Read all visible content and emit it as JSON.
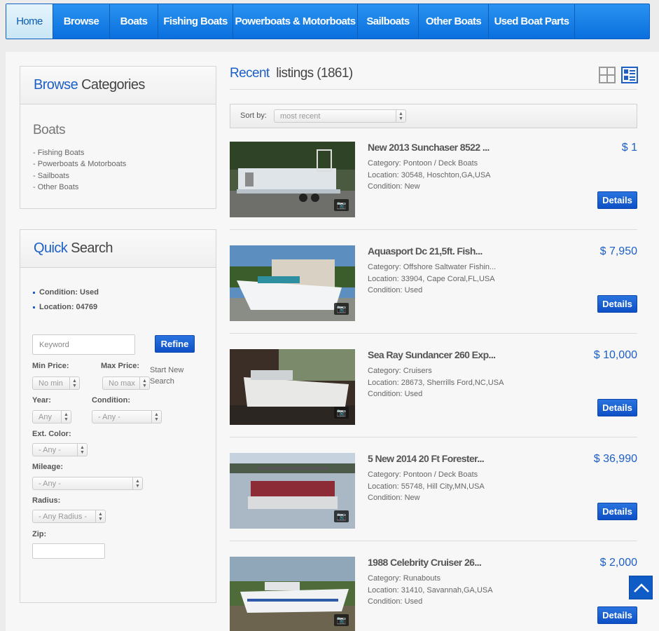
{
  "nav": {
    "items": [
      {
        "label": "Home"
      },
      {
        "label": "Browse"
      },
      {
        "label": "Boats"
      },
      {
        "label": "Fishing Boats"
      },
      {
        "label": "Powerboats & Motorboats"
      },
      {
        "label": "Sailboats"
      },
      {
        "label": "Other Boats"
      },
      {
        "label": "Used Boat Parts"
      }
    ],
    "active": "Home"
  },
  "categories": {
    "title_accent": "Browse",
    "title_rest": "Categories",
    "section": "Boats",
    "items": [
      "- Fishing Boats",
      "- Powerboats & Motorboats",
      "- Sailboats",
      "- Other Boats"
    ]
  },
  "quick_search": {
    "title_accent": "Quick",
    "title_rest": "Search",
    "filters": [
      "Condition: Used",
      "Location: 04769"
    ],
    "keyword_placeholder": "Keyword",
    "refine_label": "Refine",
    "min_price_label": "Min Price:",
    "min_price_value": "No min",
    "max_price_label": "Max Price:",
    "max_price_value": "No max",
    "start_new_search": "Start New Search",
    "year_label": "Year:",
    "year_value": "Any",
    "condition_label": "Condition:",
    "condition_value": "- Any -",
    "ext_color_label": "Ext. Color:",
    "ext_color_value": "- Any -",
    "mileage_label": "Mileage:",
    "mileage_value": "- Any -",
    "radius_label": "Radius:",
    "radius_value": "- Any Radius -",
    "zip_label": "Zip:",
    "zip_value": ""
  },
  "listings_header": {
    "title_accent": "Recent",
    "title_rest": "listings (1861)",
    "sort_label": "Sort by:",
    "sort_value": "most recent"
  },
  "listings": [
    {
      "title": "New 2013 Sunchaser 8522 ...",
      "category": "Category: Pontoon / Deck Boats",
      "location": "Location: 30548, Hoschton,GA,USA",
      "condition": "Condition: New",
      "price": "$ 1",
      "details": "Details"
    },
    {
      "title": "Aquasport Dc 21,5ft. Fish...",
      "category": "Category: Offshore Saltwater Fishin...",
      "location": "Location: 33904, Cape Coral,FL,USA",
      "condition": "Condition: Used",
      "price": "$ 7,950",
      "details": "Details"
    },
    {
      "title": "Sea Ray Sundancer 260 Exp...",
      "category": "Category: Cruisers",
      "location": "Location: 28673, Sherrills Ford,NC,USA",
      "condition": "Condition: Used",
      "price": "$ 10,000",
      "details": "Details"
    },
    {
      "title": "5 New 2014 20 Ft Forester...",
      "category": "Category: Pontoon / Deck Boats",
      "location": "Location: 55748, Hill City,MN,USA",
      "condition": "Condition: New",
      "price": "$ 36,990",
      "details": "Details"
    },
    {
      "title": "1988 Celebrity Cruiser 26...",
      "category": "Category: Runabouts",
      "location": "Location: 31410, Savannah,GA,USA",
      "condition": "Condition: Used",
      "price": "$ 2,000",
      "details": "Details"
    }
  ],
  "colors": {
    "accent": "#1c5fc7",
    "nav": "#0a6fde"
  }
}
